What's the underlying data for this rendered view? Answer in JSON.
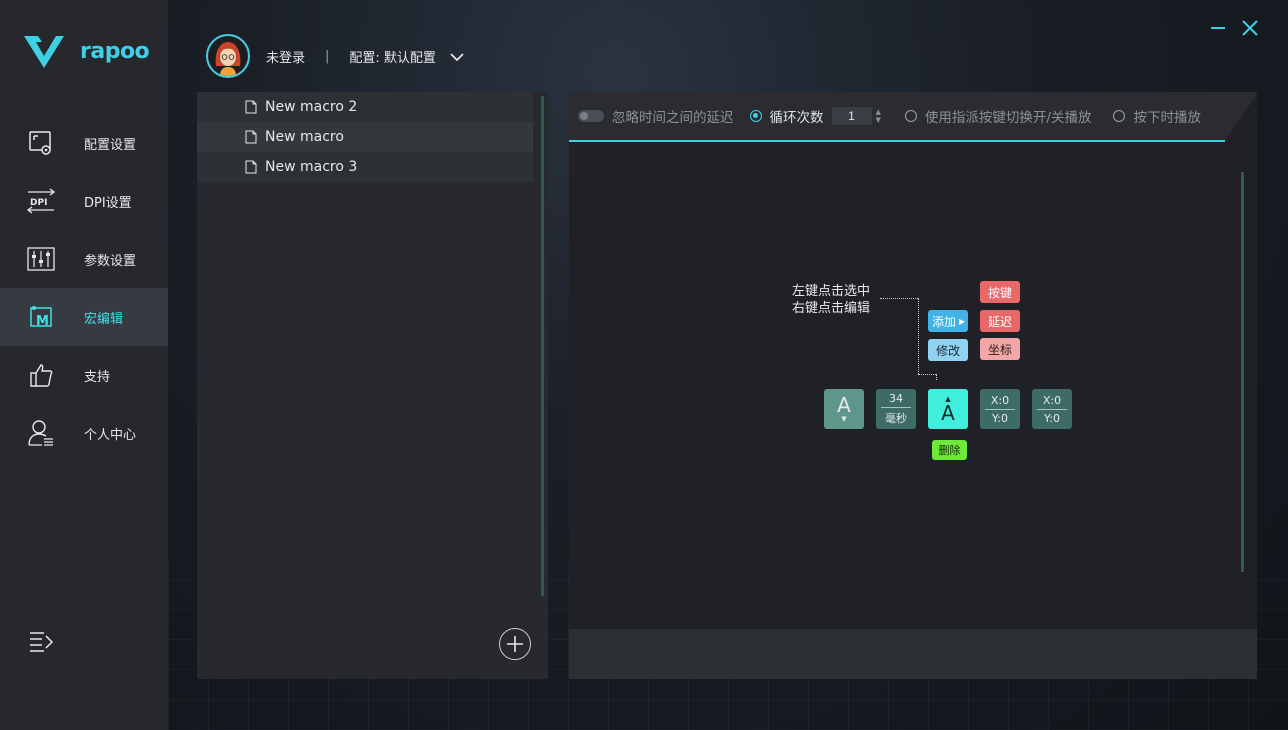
{
  "app": {
    "brand": "rapoo",
    "accent": "#3fd0e6"
  },
  "sidebar": {
    "items": [
      {
        "label": "配置设置",
        "icon": "config-icon"
      },
      {
        "label": "DPI设置",
        "icon": "dpi-icon"
      },
      {
        "label": "参数设置",
        "icon": "sliders-icon"
      },
      {
        "label": "宏编辑",
        "icon": "macro-icon",
        "active": true
      },
      {
        "label": "支持",
        "icon": "thumbs-up-icon"
      },
      {
        "label": "个人中心",
        "icon": "user-icon"
      }
    ]
  },
  "header": {
    "user": "未登录",
    "separator": "|",
    "profile": "配置: 默认配置"
  },
  "macros": [
    "New macro 2",
    "New macro",
    "New macro 3"
  ],
  "toolbar": {
    "ignore_delay": "忽略时间之间的延迟",
    "loop_count_label": "循环次数",
    "loop_count_value": "1",
    "toggle_mode": "使用指派按键切换开/关播放",
    "hold_mode": "按下时播放"
  },
  "editor": {
    "hint_line1": "左键点击选中",
    "hint_line2": "右键点击编辑",
    "add": "添加",
    "modify": "修改",
    "delete": "删除",
    "menu_key": "按键",
    "menu_delay": "延迟",
    "menu_coord": "坐标",
    "key1": "A",
    "delay_value": "34",
    "delay_unit": "毫秒",
    "key2": "A",
    "coord1_x": "X:0",
    "coord1_y": "Y:0",
    "coord2_x": "X:0",
    "coord2_y": "Y:0"
  }
}
